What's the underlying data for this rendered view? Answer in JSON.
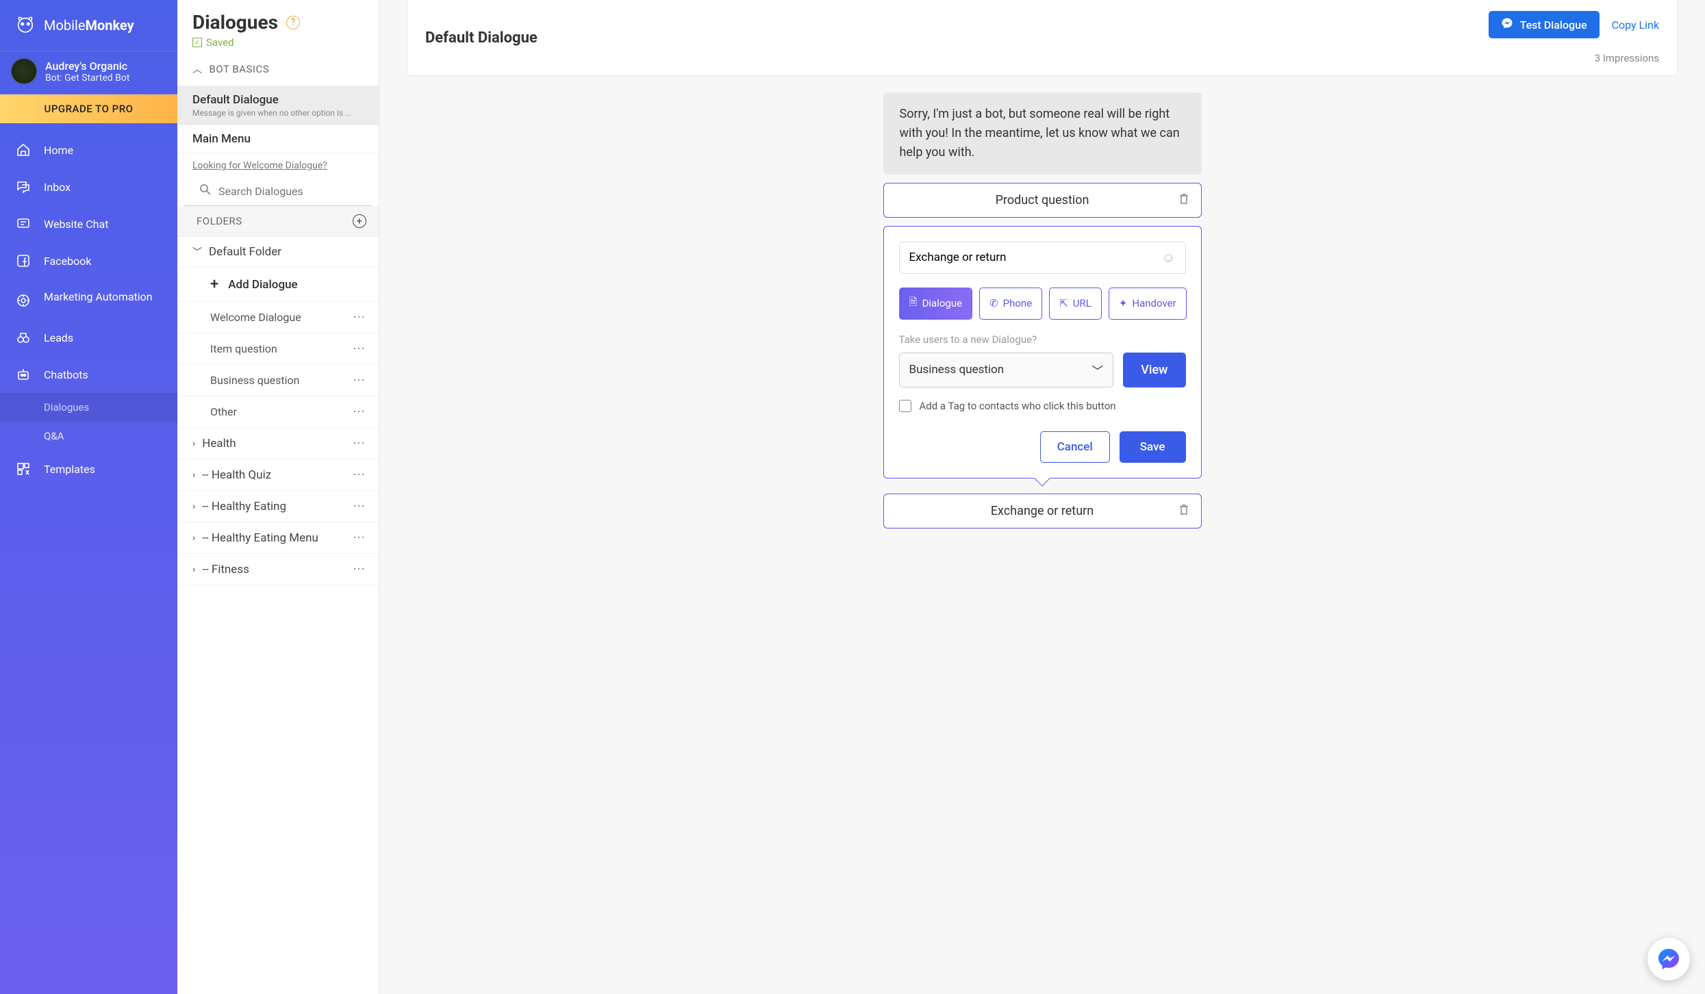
{
  "brand": {
    "name_a": "Mobile",
    "name_b": "Monkey"
  },
  "account": {
    "name": "Audrey's Organic",
    "bot": "Bot: Get Started Bot"
  },
  "upgrade": "UPGRADE TO PRO",
  "nav": {
    "home": "Home",
    "inbox": "Inbox",
    "website_chat": "Website Chat",
    "facebook": "Facebook",
    "marketing": "Marketing Automation",
    "leads": "Leads",
    "chatbots": "Chatbots",
    "dialogues": "Dialogues",
    "qa": "Q&A",
    "templates": "Templates"
  },
  "panel": {
    "title": "Dialogues",
    "saved": "Saved",
    "bot_basics": "BOT BASICS",
    "default_dialogue": "Default Dialogue",
    "default_desc": "Message is given when no other option is ...",
    "main_menu": "Main Menu",
    "welcome_link": "Looking for Welcome Dialogue?",
    "search_placeholder": "Search Dialogues",
    "folders": "FOLDERS",
    "default_folder": "Default Folder",
    "add_dialogue": "Add Dialogue",
    "items": {
      "welcome": "Welcome Dialogue",
      "item_q": "Item question",
      "biz_q": "Business question",
      "other": "Other"
    },
    "folders_list": {
      "health": "Health",
      "quiz": "-- Health Quiz",
      "eating": "-- Healthy Eating",
      "menu": "-- Healthy Eating Menu",
      "fitness": "-- Fitness"
    }
  },
  "main": {
    "title": "Default Dialogue",
    "test": "Test Dialogue",
    "copy": "Copy Link",
    "impressions": "3 Impressions",
    "bubble": "Sorry, I'm just a bot, but someone real will be right with you! In the meantime, let us know what we can help you with.",
    "chip1": "Product question",
    "edit": {
      "value": "Exchange or return",
      "tabs": {
        "dialogue": "Dialogue",
        "phone": "Phone",
        "url": "URL",
        "handover": "Handover"
      },
      "hint": "Take users to a new Dialogue?",
      "selected": "Business question",
      "view": "View",
      "tag": "Add a Tag to contacts who click this button",
      "cancel": "Cancel",
      "save": "Save"
    },
    "chip2": "Exchange or return"
  }
}
